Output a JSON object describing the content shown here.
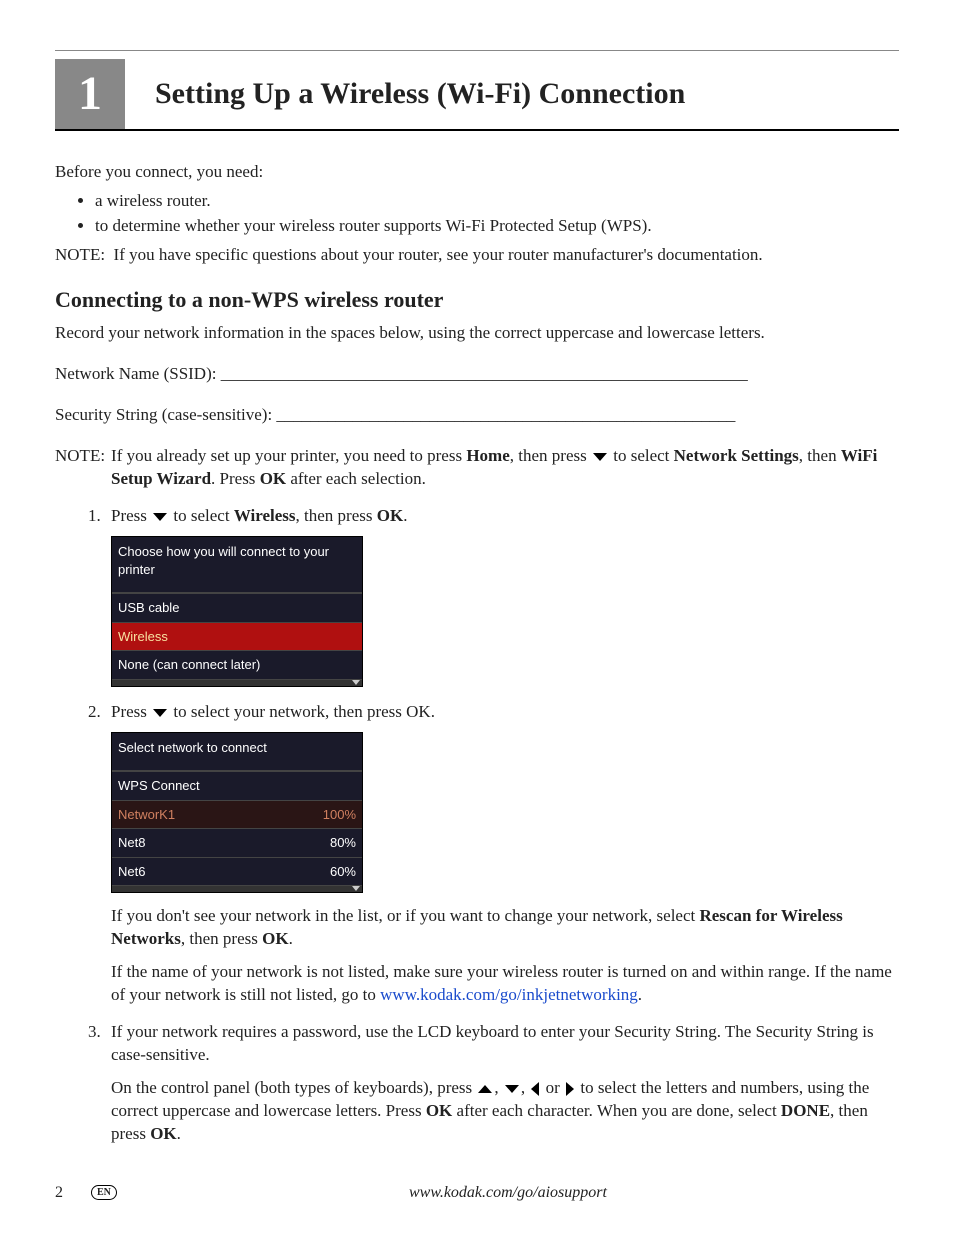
{
  "chapter": {
    "num": "1",
    "title": "Setting Up a Wireless (Wi-Fi) Connection"
  },
  "intro": "Before you connect, you need:",
  "bullets": [
    "a wireless router.",
    "to determine whether your wireless router supports Wi-Fi Protected Setup (WPS)."
  ],
  "note1_label": "NOTE:",
  "note1": "If you have specific questions about your router, see your router manufacturer's documentation.",
  "section1": "Connecting to a non-WPS wireless router",
  "section1_intro": "Record your network information in the spaces below, using the correct uppercase and lowercase letters.",
  "field_ssid": "Network Name (SSID): ______________________________________________________________",
  "field_sec": "Security String (case-sensitive): ______________________________________________________",
  "note2": {
    "label": "NOTE:",
    "pre": "If you already set up your printer, you need to press ",
    "home": "Home",
    "mid1": ", then press ",
    "mid2": " to select ",
    "net": "Network Settings",
    "mid3": ", then ",
    "wiz": "WiFi Setup Wizard",
    "mid4": ". Press ",
    "ok": "OK",
    "end": " after each selection."
  },
  "step1": {
    "pre": "Press ",
    "mid": " to select ",
    "wireless": "Wireless",
    "mid2": ", then press ",
    "ok": "OK",
    "end": "."
  },
  "lcd1": {
    "header": "Choose how you will connect to your printer",
    "rows": [
      "USB cable",
      "Wireless",
      "None (can connect later)"
    ]
  },
  "step2": {
    "pre": "Press ",
    "mid": " to select your network, then press OK."
  },
  "lcd2": {
    "header": "Select network to connect",
    "rows": [
      {
        "name": "WPS Connect",
        "val": ""
      },
      {
        "name": "NetworK1",
        "val": "100%"
      },
      {
        "name": "Net8",
        "val": "80%"
      },
      {
        "name": "Net6",
        "val": "60%"
      }
    ]
  },
  "after2a": {
    "pre": "If you don't see your network in the list, or if you want to change your network, select ",
    "rescan": "Rescan for Wireless Networks",
    "mid": ", then press ",
    "ok": "OK",
    "end": "."
  },
  "after2b": {
    "pre": "If the name of your network is not listed, make sure your wireless router is turned on and within range. If the name of your network is still not listed, go to ",
    "link": "www.kodak.com/go/inkjetnetworking",
    "end": "."
  },
  "step3a": "If your network requires a password, use the LCD keyboard to enter your Security String. The Security String is case-sensitive.",
  "step3b": {
    "pre": "On the control panel (both types of keyboards), press ",
    "sep1": ", ",
    "sep2": ", ",
    "or": " or ",
    "mid": " to select the letters and numbers, using the correct uppercase and lowercase letters. Press ",
    "ok": "OK",
    "mid2": " after each character. When you are done, select ",
    "done": "DONE",
    "mid3": ", then press ",
    "ok2": "OK",
    "end": "."
  },
  "footer": {
    "page": "2",
    "lang": "EN",
    "url": "www.kodak.com/go/aiosupport"
  }
}
